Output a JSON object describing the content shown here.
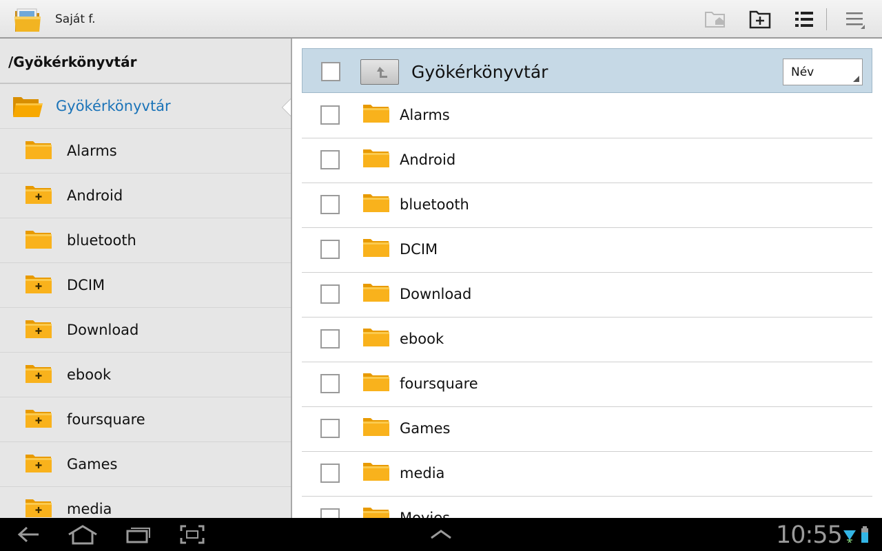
{
  "actionbar": {
    "title": "Saját f.",
    "icons": [
      "app-folder-icon",
      "home-folder-icon",
      "new-folder-icon",
      "list-view-icon",
      "overflow-menu-icon"
    ]
  },
  "left_pane": {
    "path": "/Gyökérkönyvtár",
    "root_label": "Gyökérkönyvtár",
    "items": [
      {
        "label": "Alarms",
        "expandable": false
      },
      {
        "label": "Android",
        "expandable": true
      },
      {
        "label": "bluetooth",
        "expandable": false
      },
      {
        "label": "DCIM",
        "expandable": true
      },
      {
        "label": "Download",
        "expandable": true
      },
      {
        "label": "ebook",
        "expandable": true
      },
      {
        "label": "foursquare",
        "expandable": true
      },
      {
        "label": "Games",
        "expandable": true
      },
      {
        "label": "media",
        "expandable": true
      }
    ]
  },
  "right_pane": {
    "header_title": "Gyökérkönyvtár",
    "sort_value": "Név",
    "rows": [
      "Alarms",
      "Android",
      "bluetooth",
      "DCIM",
      "Download",
      "ebook",
      "foursquare",
      "Games",
      "media",
      "Movies"
    ]
  },
  "system_bar": {
    "time": "10:55",
    "icons": [
      "back-icon",
      "home-icon",
      "recent-apps-icon",
      "screenshot-icon",
      "up-chevron-icon",
      "wifi-icon",
      "battery-icon"
    ]
  },
  "colors": {
    "accent": "#1a73b8",
    "folder": "#f7a800",
    "selected_header": "#c6d9e6"
  }
}
